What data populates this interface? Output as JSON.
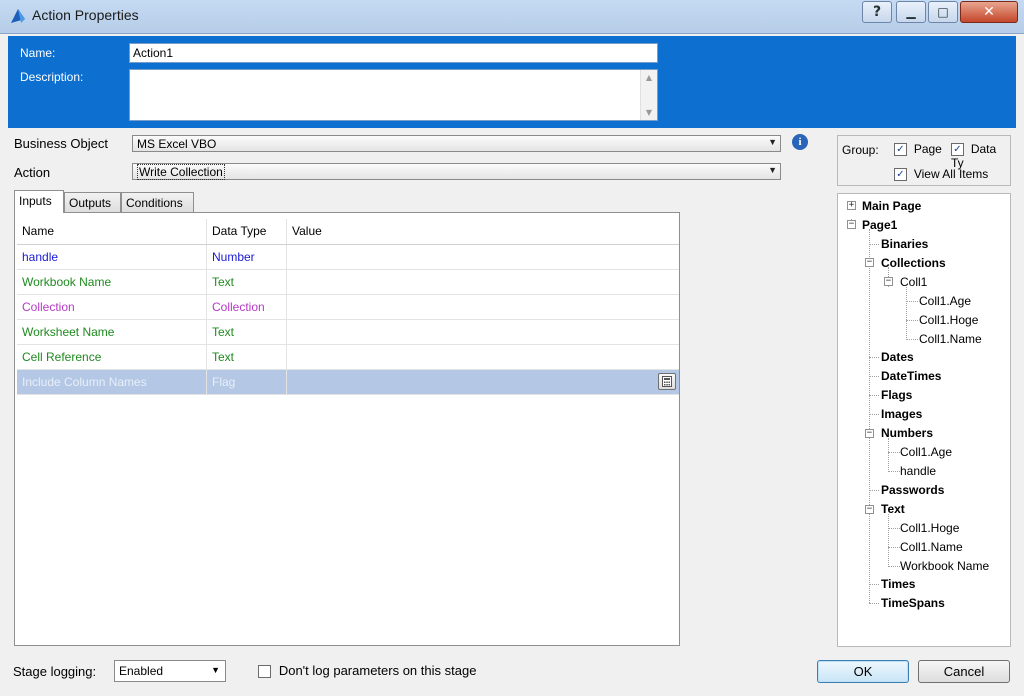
{
  "window": {
    "title": "Action Properties",
    "help_glyph": "?",
    "minimize_glyph": "▁",
    "maximize_glyph": "□",
    "close_glyph": "✕"
  },
  "header": {
    "name_label": "Name:",
    "name_value": "Action1",
    "description_label": "Description:",
    "description_value": ""
  },
  "form": {
    "business_object_label": "Business Object",
    "business_object_value": "MS Excel VBO",
    "action_label": "Action",
    "action_value": "Write Collection",
    "info_glyph": "i"
  },
  "tabs": [
    {
      "label": "Inputs",
      "active": true
    },
    {
      "label": "Outputs",
      "active": false
    },
    {
      "label": "Conditions",
      "active": false
    }
  ],
  "grid": {
    "columns": [
      "Name",
      "Data Type",
      "Value"
    ],
    "rows": [
      {
        "name": "handle",
        "type": "Number",
        "value": "",
        "color": "#1a1ad6"
      },
      {
        "name": "Workbook Name",
        "type": "Text",
        "value": "",
        "color": "#1f8a1f"
      },
      {
        "name": "Collection",
        "type": "Collection",
        "value": "",
        "color": "#b43bc4"
      },
      {
        "name": "Worksheet Name",
        "type": "Text",
        "value": "",
        "color": "#1f8a1f"
      },
      {
        "name": "Cell Reference",
        "type": "Text",
        "value": "",
        "color": "#1f8a1f"
      },
      {
        "name": "Include Column Names",
        "type": "Flag",
        "value": "",
        "color": "#e8eef8",
        "selected": true
      }
    ]
  },
  "group": {
    "label": "Group:",
    "page_label": "Page",
    "datatype_label": "Data Ty",
    "view_all_label": "View All Items",
    "check_glyph": "✓"
  },
  "tree": {
    "items": [
      {
        "label": "Main Page",
        "bold": true
      },
      {
        "label": "Page1",
        "bold": true
      },
      {
        "label": "Binaries",
        "bold": true
      },
      {
        "label": "Collections",
        "bold": true
      },
      {
        "label": "Coll1",
        "bold": false
      },
      {
        "label": "Coll1.Age",
        "bold": false
      },
      {
        "label": "Coll1.Hoge",
        "bold": false
      },
      {
        "label": "Coll1.Name",
        "bold": false
      },
      {
        "label": "Dates",
        "bold": true
      },
      {
        "label": "DateTimes",
        "bold": true
      },
      {
        "label": "Flags",
        "bold": true
      },
      {
        "label": "Images",
        "bold": true
      },
      {
        "label": "Numbers",
        "bold": true
      },
      {
        "label": "Coll1.Age",
        "bold": false
      },
      {
        "label": "handle",
        "bold": false
      },
      {
        "label": "Passwords",
        "bold": true
      },
      {
        "label": "Text",
        "bold": true
      },
      {
        "label": "Coll1.Hoge",
        "bold": false
      },
      {
        "label": "Coll1.Name",
        "bold": false
      },
      {
        "label": "Workbook Name",
        "bold": false
      },
      {
        "label": "Times",
        "bold": true
      },
      {
        "label": "TimeSpans",
        "bold": true
      }
    ],
    "expand_glyph": "+",
    "collapse_glyph": "−"
  },
  "footer": {
    "stage_logging_label": "Stage logging:",
    "stage_logging_value": "Enabled",
    "dont_log_label": "Don't log parameters on this stage",
    "ok_label": "OK",
    "cancel_label": "Cancel"
  }
}
